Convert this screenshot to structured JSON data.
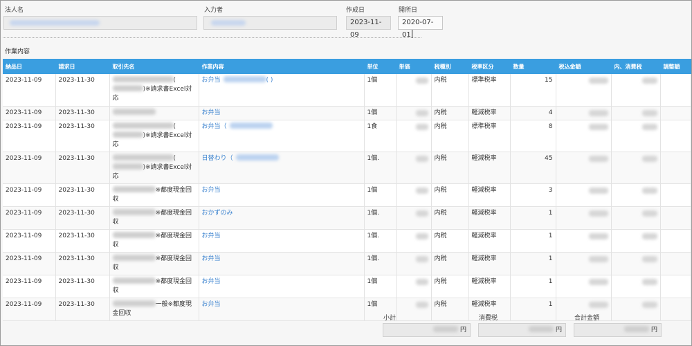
{
  "header": {
    "corporate_label": "法人名",
    "inputter_label": "入力者",
    "created_label": "作成日",
    "created_value": "2023-11-09",
    "opened_label": "開所日",
    "opened_value": "2020-07-01"
  },
  "section_title": "作業内容",
  "columns": [
    "納品日",
    "請求日",
    "取引先名",
    "作業内容",
    "単位",
    "単価",
    "税種別",
    "税率区分",
    "数量",
    "税込金額",
    "内、消費税",
    "調整額"
  ],
  "rows": [
    {
      "delivery": "2023-11-09",
      "billing": "2023-11-30",
      "client_suffix": "(",
      "client_note": ")※請求書Excel対応",
      "work": "お弁当",
      "work_extra": "(                )",
      "unit": "1個",
      "tax_type": "内税",
      "tax_rate": "標準税率",
      "qty": "15"
    },
    {
      "delivery": "2023-11-09",
      "billing": "2023-11-30",
      "client_suffix": "",
      "client_note": "",
      "work": "お弁当",
      "work_extra": "",
      "unit": "1個",
      "tax_type": "内税",
      "tax_rate": "軽減税率",
      "qty": "4"
    },
    {
      "delivery": "2023-11-09",
      "billing": "2023-11-30",
      "client_suffix": "(",
      "client_note": ")※請求書Excel対応",
      "work": "お弁当（",
      "work_extra": "",
      "unit": "1食",
      "tax_type": "内税",
      "tax_rate": "標準税率",
      "qty": "8"
    },
    {
      "delivery": "2023-11-09",
      "billing": "2023-11-30",
      "client_suffix": "(",
      "client_note": ")※請求書Excel対応",
      "work": "日替わり（",
      "work_extra": "",
      "unit": "1個.",
      "tax_type": "内税",
      "tax_rate": "軽減税率",
      "qty": "45"
    },
    {
      "delivery": "2023-11-09",
      "billing": "2023-11-30",
      "client_suffix": "",
      "client_note": "※都度現金回収",
      "work": "お弁当",
      "work_extra": "",
      "unit": "1個",
      "tax_type": "内税",
      "tax_rate": "軽減税率",
      "qty": "3"
    },
    {
      "delivery": "2023-11-09",
      "billing": "2023-11-30",
      "client_suffix": "",
      "client_note": "※都度現金回収",
      "work": "おかずのみ",
      "work_extra": "",
      "unit": "1個.",
      "tax_type": "内税",
      "tax_rate": "軽減税率",
      "qty": "1"
    },
    {
      "delivery": "2023-11-09",
      "billing": "2023-11-30",
      "client_suffix": "",
      "client_note": "※都度現金回収",
      "work": "お弁当",
      "work_extra": "",
      "unit": "1個.",
      "tax_type": "内税",
      "tax_rate": "軽減税率",
      "qty": "1"
    },
    {
      "delivery": "2023-11-09",
      "billing": "2023-11-30",
      "client_suffix": "",
      "client_note": "※都度現金回収",
      "work": "お弁当",
      "work_extra": "",
      "unit": "1個.",
      "tax_type": "内税",
      "tax_rate": "軽減税率",
      "qty": "1"
    },
    {
      "delivery": "2023-11-09",
      "billing": "2023-11-30",
      "client_suffix": "",
      "client_note": "※都度現金回収",
      "work": "お弁当",
      "work_extra": "",
      "unit": "1個",
      "tax_type": "内税",
      "tax_rate": "軽減税率",
      "qty": "1"
    },
    {
      "delivery": "2023-11-09",
      "billing": "2023-11-30",
      "client_suffix": "",
      "client_note": "一般※都度現金回収",
      "work": "お弁当",
      "work_extra": "",
      "unit": "1個",
      "tax_type": "内税",
      "tax_rate": "軽減税率",
      "qty": "1"
    }
  ],
  "footer": {
    "subtotal_label": "小計",
    "tax_label": "消費税",
    "total_label": "合計金額",
    "currency": "円"
  }
}
